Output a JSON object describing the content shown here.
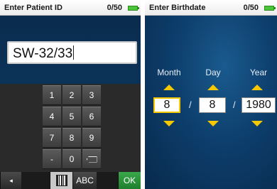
{
  "left_screen": {
    "title": "Enter Patient ID",
    "counter": "0/50",
    "entry_value": "SW-32/33",
    "keypad": {
      "rows": [
        [
          "1",
          "2",
          "3"
        ],
        [
          "4",
          "5",
          "6"
        ],
        [
          "7",
          "8",
          "9"
        ],
        [
          "-",
          "0",
          ""
        ]
      ],
      "backspace_icon": "backspace-icon"
    },
    "softkeys": {
      "back_symbol": "◂",
      "barcode_icon": "barcode-icon",
      "abc_label": "ABC",
      "ok_label": "OK"
    }
  },
  "right_screen": {
    "title": "Enter Birthdate",
    "counter": "0/50",
    "columns": [
      {
        "label": "Month",
        "value": "8"
      },
      {
        "label": "Day",
        "value": "8"
      },
      {
        "label": "Year",
        "value": "1980"
      }
    ],
    "separator": "/"
  },
  "colors": {
    "accent_yellow": "#f5c800",
    "ok_green": "#2e9a3e",
    "battery_green": "#4cc53a",
    "background_blue": "#0d3e6c"
  }
}
